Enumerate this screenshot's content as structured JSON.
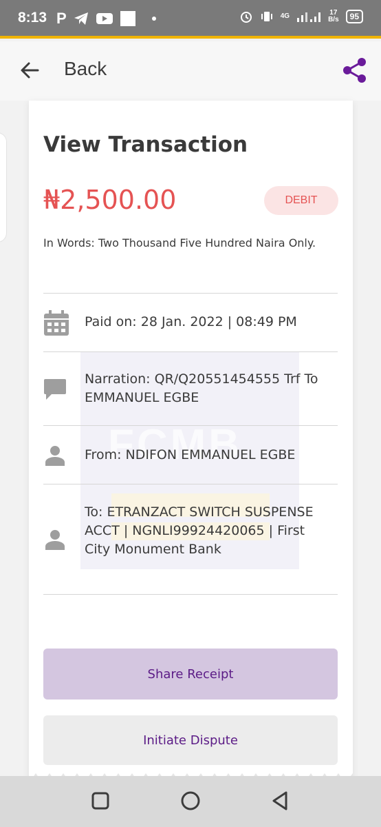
{
  "status_bar": {
    "time": "8:13",
    "p_label": "P",
    "network_type": "4G",
    "speed_value": "17",
    "speed_unit": "B/s",
    "battery": "95"
  },
  "app_bar": {
    "back_label": "Back",
    "accent_color": "#6a1b9a"
  },
  "transaction": {
    "title": "View Transaction",
    "amount": "₦2,500.00",
    "type_badge": "DEBIT",
    "in_words": "In Words: Two Thousand Five Hundred  Naira Only.",
    "paid_on": "Paid on: 28 Jan. 2022 | 08:49 PM",
    "narration": "Narration:  QR/Q20551454555 Trf To EMMANUEL EGBE",
    "from": "From: NDIFON EMMANUEL EGBE",
    "to": "To: ETRANZACT SWITCH SUSPENSE ACCT | NGNLI99924420065 | First City Monument Bank",
    "watermark": "FCMB"
  },
  "actions": {
    "share_receipt": "Share Receipt",
    "initiate_dispute": "Initiate Dispute"
  },
  "icons": [
    "back-arrow-icon",
    "share-icon",
    "calendar-icon",
    "chat-icon",
    "person-icon",
    "square-icon",
    "circle-icon",
    "triangle-back-icon"
  ]
}
